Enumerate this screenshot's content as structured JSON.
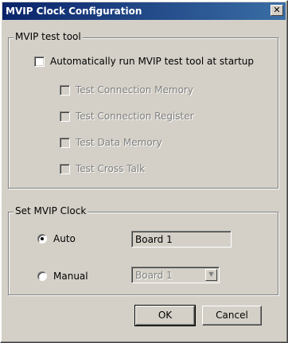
{
  "window": {
    "title": "MVIP Clock Configuration",
    "close_glyph": "✕"
  },
  "test_tool": {
    "group_title": "MVIP test tool",
    "auto_run_label": "Automatically run MVIP test tool at startup",
    "options": [
      "Test Connection Memory",
      "Test Connection Register",
      "Test Data Memory",
      "Test Cross Talk"
    ]
  },
  "clock": {
    "group_title": "Set MVIP Clock",
    "auto_label": "Auto",
    "auto_value": "Board 1",
    "manual_label": "Manual",
    "manual_value": "Board 1",
    "selected": "Auto"
  },
  "buttons": {
    "ok": "OK",
    "cancel": "Cancel"
  },
  "colors": {
    "title_start": "#0a246a",
    "title_end": "#3a6ea5",
    "face": "#d4d0c8"
  },
  "icons": {
    "close": "close-icon",
    "dropdown": "chevron-down-icon"
  }
}
